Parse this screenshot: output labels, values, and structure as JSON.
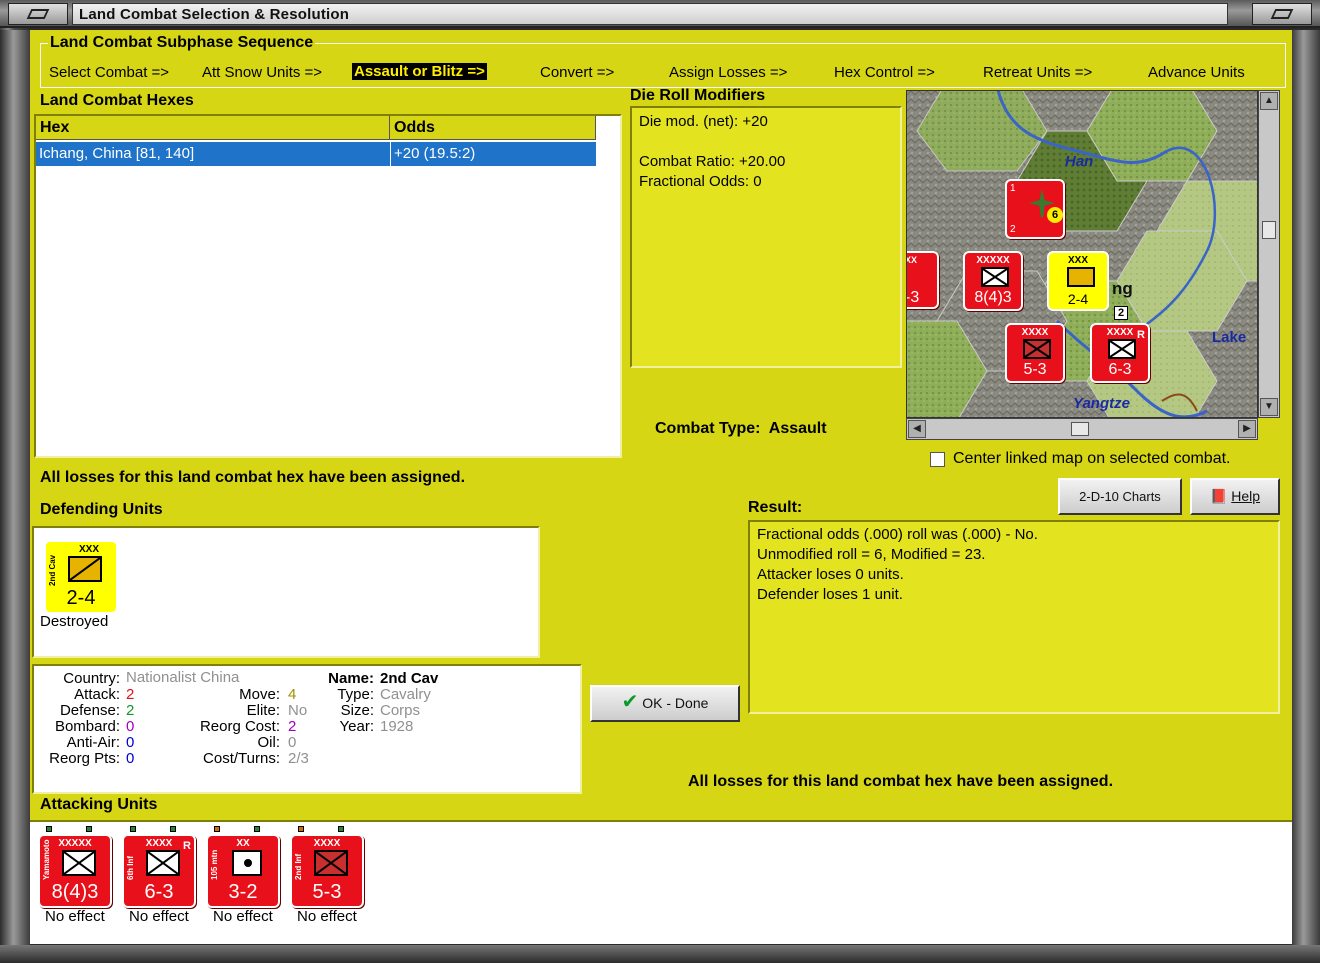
{
  "window": {
    "title": "Land Combat Selection & Resolution"
  },
  "sequence": {
    "legend": "Land Combat Subphase Sequence",
    "items": [
      "Select Combat =>",
      "Att Snow Units =>",
      "Assault or Blitz =>",
      "Convert =>",
      "Assign Losses =>",
      "Hex Control =>",
      "Retreat Units =>",
      "Advance Units"
    ],
    "active_index": 2
  },
  "hexes": {
    "title": "Land Combat Hexes",
    "columns": [
      "Hex",
      "Odds"
    ],
    "rows": [
      {
        "hex": "Ichang, China [81, 140]",
        "odds": "+20 (19.5:2)"
      }
    ]
  },
  "die_roll": {
    "title": "Die Roll Modifiers",
    "lines": [
      "Die mod. (net): +20",
      "Combat Ratio: +20.00",
      "Fractional Odds: 0"
    ]
  },
  "map": {
    "labels": [
      "Han",
      "Lake",
      "Yangtze",
      "ng"
    ],
    "stack_count": "2",
    "units": [
      {
        "name": "air",
        "strength": "",
        "top_num": "1",
        "bottom_num": "2",
        "badge": "6"
      },
      {
        "size": "XX",
        "strength": "-3"
      },
      {
        "size": "XXXXX",
        "strength": "8(4)3"
      },
      {
        "size": "XXX",
        "strength": "2-4"
      },
      {
        "size": "XXXX",
        "strength": "5-3"
      },
      {
        "size": "XXXX",
        "strength": "6-3",
        "r": "R"
      }
    ]
  },
  "combat_type": {
    "label": "Combat Type:",
    "value": "Assault"
  },
  "center_map": {
    "label": "Center linked map on selected combat.",
    "checked": false
  },
  "losses_msg_top": "All losses for this land combat hex have been assigned.",
  "losses_msg_bottom": "All losses for this land combat hex have been assigned.",
  "defending": {
    "title": "Defending Units",
    "units": [
      {
        "name": "2nd Cav",
        "size": "XXX",
        "strength": "2-4",
        "status": "Destroyed"
      }
    ]
  },
  "unit_info": {
    "country_label": "Country:",
    "country": "Nationalist China",
    "attack_label": "Attack:",
    "attack": "2",
    "defense_label": "Defense:",
    "defense": "2",
    "bombard_label": "Bombard:",
    "bombard": "0",
    "antiair_label": "Anti-Air:",
    "antiair": "0",
    "reorgpts_label": "Reorg Pts:",
    "reorgpts": "0",
    "move_label": "Move:",
    "move": "4",
    "elite_label": "Elite:",
    "elite": "No",
    "reorgcost_label": "Reorg Cost:",
    "reorgcost": "2",
    "oil_label": "Oil:",
    "oil": "0",
    "costturns_label": "Cost/Turns:",
    "costturns": "2/3",
    "name_label": "Name:",
    "name": "2nd Cav",
    "type_label": "Type:",
    "type": "Cavalry",
    "size_label": "Size:",
    "size": "Corps",
    "year_label": "Year:",
    "year": "1928"
  },
  "result": {
    "title": "Result:",
    "lines": [
      "Fractional odds (.000) roll was (.000)  - No.",
      "Unmodified roll = 6, Modified = 23.",
      "Attacker loses 0 units.",
      "Defender loses 1 unit."
    ]
  },
  "buttons": {
    "charts": "2-D-10 Charts",
    "help": "Help",
    "ok": "OK - Done"
  },
  "attacking": {
    "title": "Attacking Units",
    "units": [
      {
        "name": "Yamamoto",
        "size": "XXXXX",
        "strength": "8(4)3",
        "status": "No effect",
        "r": ""
      },
      {
        "name": "6th Inf",
        "size": "XXXX",
        "strength": "6-3",
        "status": "No effect",
        "r": "R"
      },
      {
        "name": "105 mtn",
        "size": "XX",
        "strength": "3-2",
        "status": "No effect",
        "r": ""
      },
      {
        "name": "2nd Inf",
        "size": "XXXX",
        "strength": "5-3",
        "status": "No effect",
        "r": ""
      }
    ]
  },
  "colors": {
    "panel": "#d6d615",
    "unit_red": "#e8101a",
    "unit_yellow": "#ffff00",
    "selection": "#1f73c9"
  }
}
